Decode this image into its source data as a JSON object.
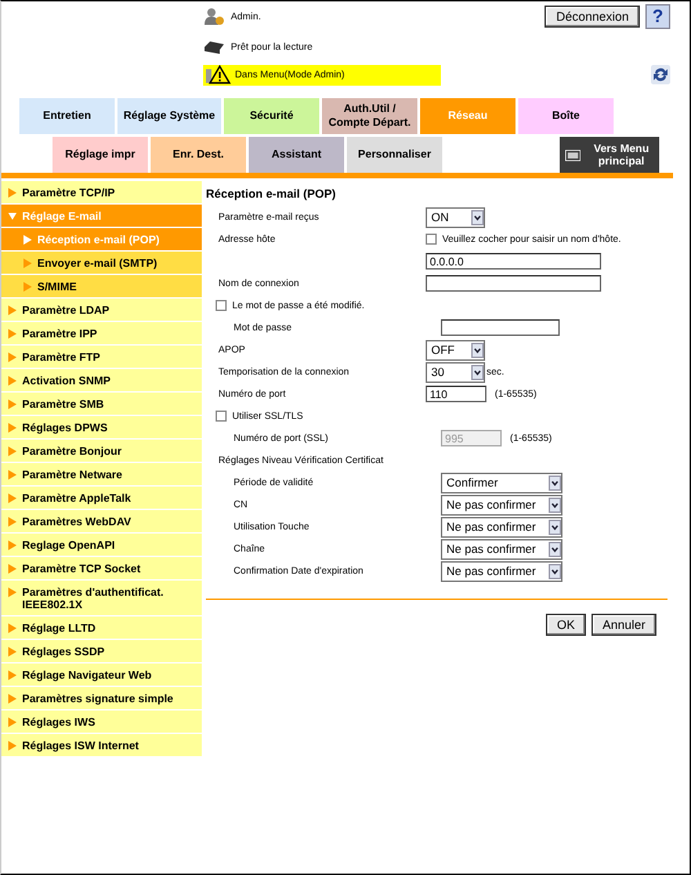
{
  "header": {
    "user": "Admin.",
    "logout": "Déconnexion",
    "help": "?",
    "status": "Prêt pour la lecture",
    "alert": "Dans Menu(Mode Admin)"
  },
  "tabs_row1": [
    {
      "label": "Entretien",
      "selected": false,
      "color": "#d6e8fa"
    },
    {
      "label": "Réglage Système",
      "selected": false,
      "color": "#d6e8fa"
    },
    {
      "label": "Sécurité",
      "selected": false,
      "color": "#ccf59a"
    },
    {
      "label": "Auth.Util / Compte Départ.",
      "selected": false,
      "color": "#d9b8b0"
    },
    {
      "label": "Réseau",
      "selected": true,
      "color": "#ff9900"
    },
    {
      "label": "Boîte",
      "selected": false,
      "color": "#ffccff"
    }
  ],
  "tabs_row2": [
    {
      "label": "Réglage impr",
      "selected": false,
      "color": "#ffcccc"
    },
    {
      "label": "Enr. Dest.",
      "selected": false,
      "color": "#ffcc99"
    },
    {
      "label": "Assistant",
      "selected": false,
      "color": "#bdb8c8"
    },
    {
      "label": "Personnaliser",
      "selected": false,
      "color": "#dddddd"
    }
  ],
  "main_menu_button": "Vers Menu principal",
  "sidebar": [
    {
      "label": "Paramètre TCP/IP",
      "expanded": false
    },
    {
      "label": "Réglage E-mail",
      "expanded": true,
      "children": [
        {
          "label": "Réception e-mail (POP)",
          "selected": true
        },
        {
          "label": "Envoyer e-mail (SMTP)",
          "selected": false
        },
        {
          "label": "S/MIME",
          "selected": false
        }
      ]
    },
    {
      "label": "Paramètre LDAP",
      "expanded": false
    },
    {
      "label": "Paramètre IPP",
      "expanded": false
    },
    {
      "label": "Paramètre FTP",
      "expanded": false
    },
    {
      "label": "Activation SNMP",
      "expanded": false
    },
    {
      "label": "Paramètre SMB",
      "expanded": false
    },
    {
      "label": "Réglages DPWS",
      "expanded": false
    },
    {
      "label": "Paramètre Bonjour",
      "expanded": false
    },
    {
      "label": "Paramètre Netware",
      "expanded": false
    },
    {
      "label": "Paramètre AppleTalk",
      "expanded": false
    },
    {
      "label": "Paramètres WebDAV",
      "expanded": false
    },
    {
      "label": "Reglage OpenAPI",
      "expanded": false
    },
    {
      "label": "Paramètre TCP Socket",
      "expanded": false
    },
    {
      "label": "Paramètres d'authentificat. IEEE802.1X",
      "expanded": false
    },
    {
      "label": "Réglage LLTD",
      "expanded": false
    },
    {
      "label": "Réglages SSDP",
      "expanded": false
    },
    {
      "label": "Réglage Navigateur Web",
      "expanded": false
    },
    {
      "label": "Paramètres signature simple",
      "expanded": false
    },
    {
      "label": "Réglages IWS",
      "expanded": false
    },
    {
      "label": "Réglages ISW Internet",
      "expanded": false
    }
  ],
  "form": {
    "title": "Réception e-mail (POP)",
    "rows": [
      {
        "kind": "select",
        "label": "Paramètre e-mail reçus",
        "value": "ON"
      },
      {
        "kind": "label-check",
        "label": "Adresse hôte",
        "check_label": "Veuillez cocher pour saisir un nom d'hôte.",
        "checked": false
      },
      {
        "kind": "wide",
        "value": "0.0.0.0"
      },
      {
        "kind": "wide",
        "label": "Nom de connexion"
      },
      {
        "kind": "check",
        "label": "Le mot de passe a été modifié.",
        "checked": false,
        "children": [
          {
            "kind": "medium",
            "label": "Mot de passe"
          }
        ]
      },
      {
        "kind": "select",
        "label": "APOP",
        "value": "OFF"
      },
      {
        "kind": "select",
        "label": "Temporisation de la connexion",
        "value": "30",
        "unit": "sec."
      },
      {
        "kind": "short",
        "label": "Numéro de port",
        "value": "110",
        "hint": "(1-65535)"
      },
      {
        "kind": "check",
        "label": "Utiliser SSL/TLS",
        "checked": false,
        "children": [
          {
            "kind": "short",
            "label": "Numéro de port (SSL)",
            "value": "995",
            "hint": "(1-65535)",
            "disabled": true
          }
        ]
      },
      {
        "kind": "group",
        "label": "Réglages Niveau Vérification Certificat",
        "children": [
          {
            "kind": "select-wide",
            "label": "Période de validité",
            "value": "Confirmer"
          },
          {
            "kind": "select-wide",
            "label": "CN",
            "value": "Ne pas confirmer"
          },
          {
            "kind": "select-wide",
            "label": "Utilisation Touche",
            "value": "Ne pas confirmer"
          },
          {
            "kind": "select-wide",
            "label": "Chaîne",
            "value": "Ne pas confirmer"
          },
          {
            "kind": "select-wide",
            "label": "Confirmation Date d'expiration",
            "value": "Ne pas confirmer"
          }
        ]
      }
    ],
    "buttons": [
      "OK",
      "Annuler"
    ]
  }
}
